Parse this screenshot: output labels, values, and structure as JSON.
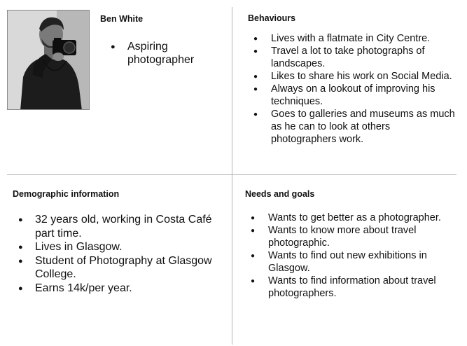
{
  "persona": {
    "name": "Ben White",
    "tagline": [
      "Aspiring photographer"
    ]
  },
  "behaviours": {
    "heading": "Behaviours",
    "items": [
      "Lives with a flatmate in City Centre.",
      "Travel a lot to take photographs of landscapes.",
      "Likes to share his work on Social Media.",
      "Always on a lookout of improving his techniques.",
      "Goes to galleries and museums as much as he can to look at others photographers work."
    ]
  },
  "demographic": {
    "heading": "Demographic information",
    "items": [
      "32 years old, working in Costa Café part time.",
      "Lives in Glasgow.",
      "Student of Photography at Glasgow College.",
      "Earns 14k/per year."
    ]
  },
  "needs": {
    "heading": "Needs and goals",
    "items": [
      "Wants to get better as a photographer.",
      "Wants to know more about travel photographic.",
      "Wants to find out new exhibitions in Glasgow.",
      "Wants to find information about travel photographers."
    ]
  }
}
